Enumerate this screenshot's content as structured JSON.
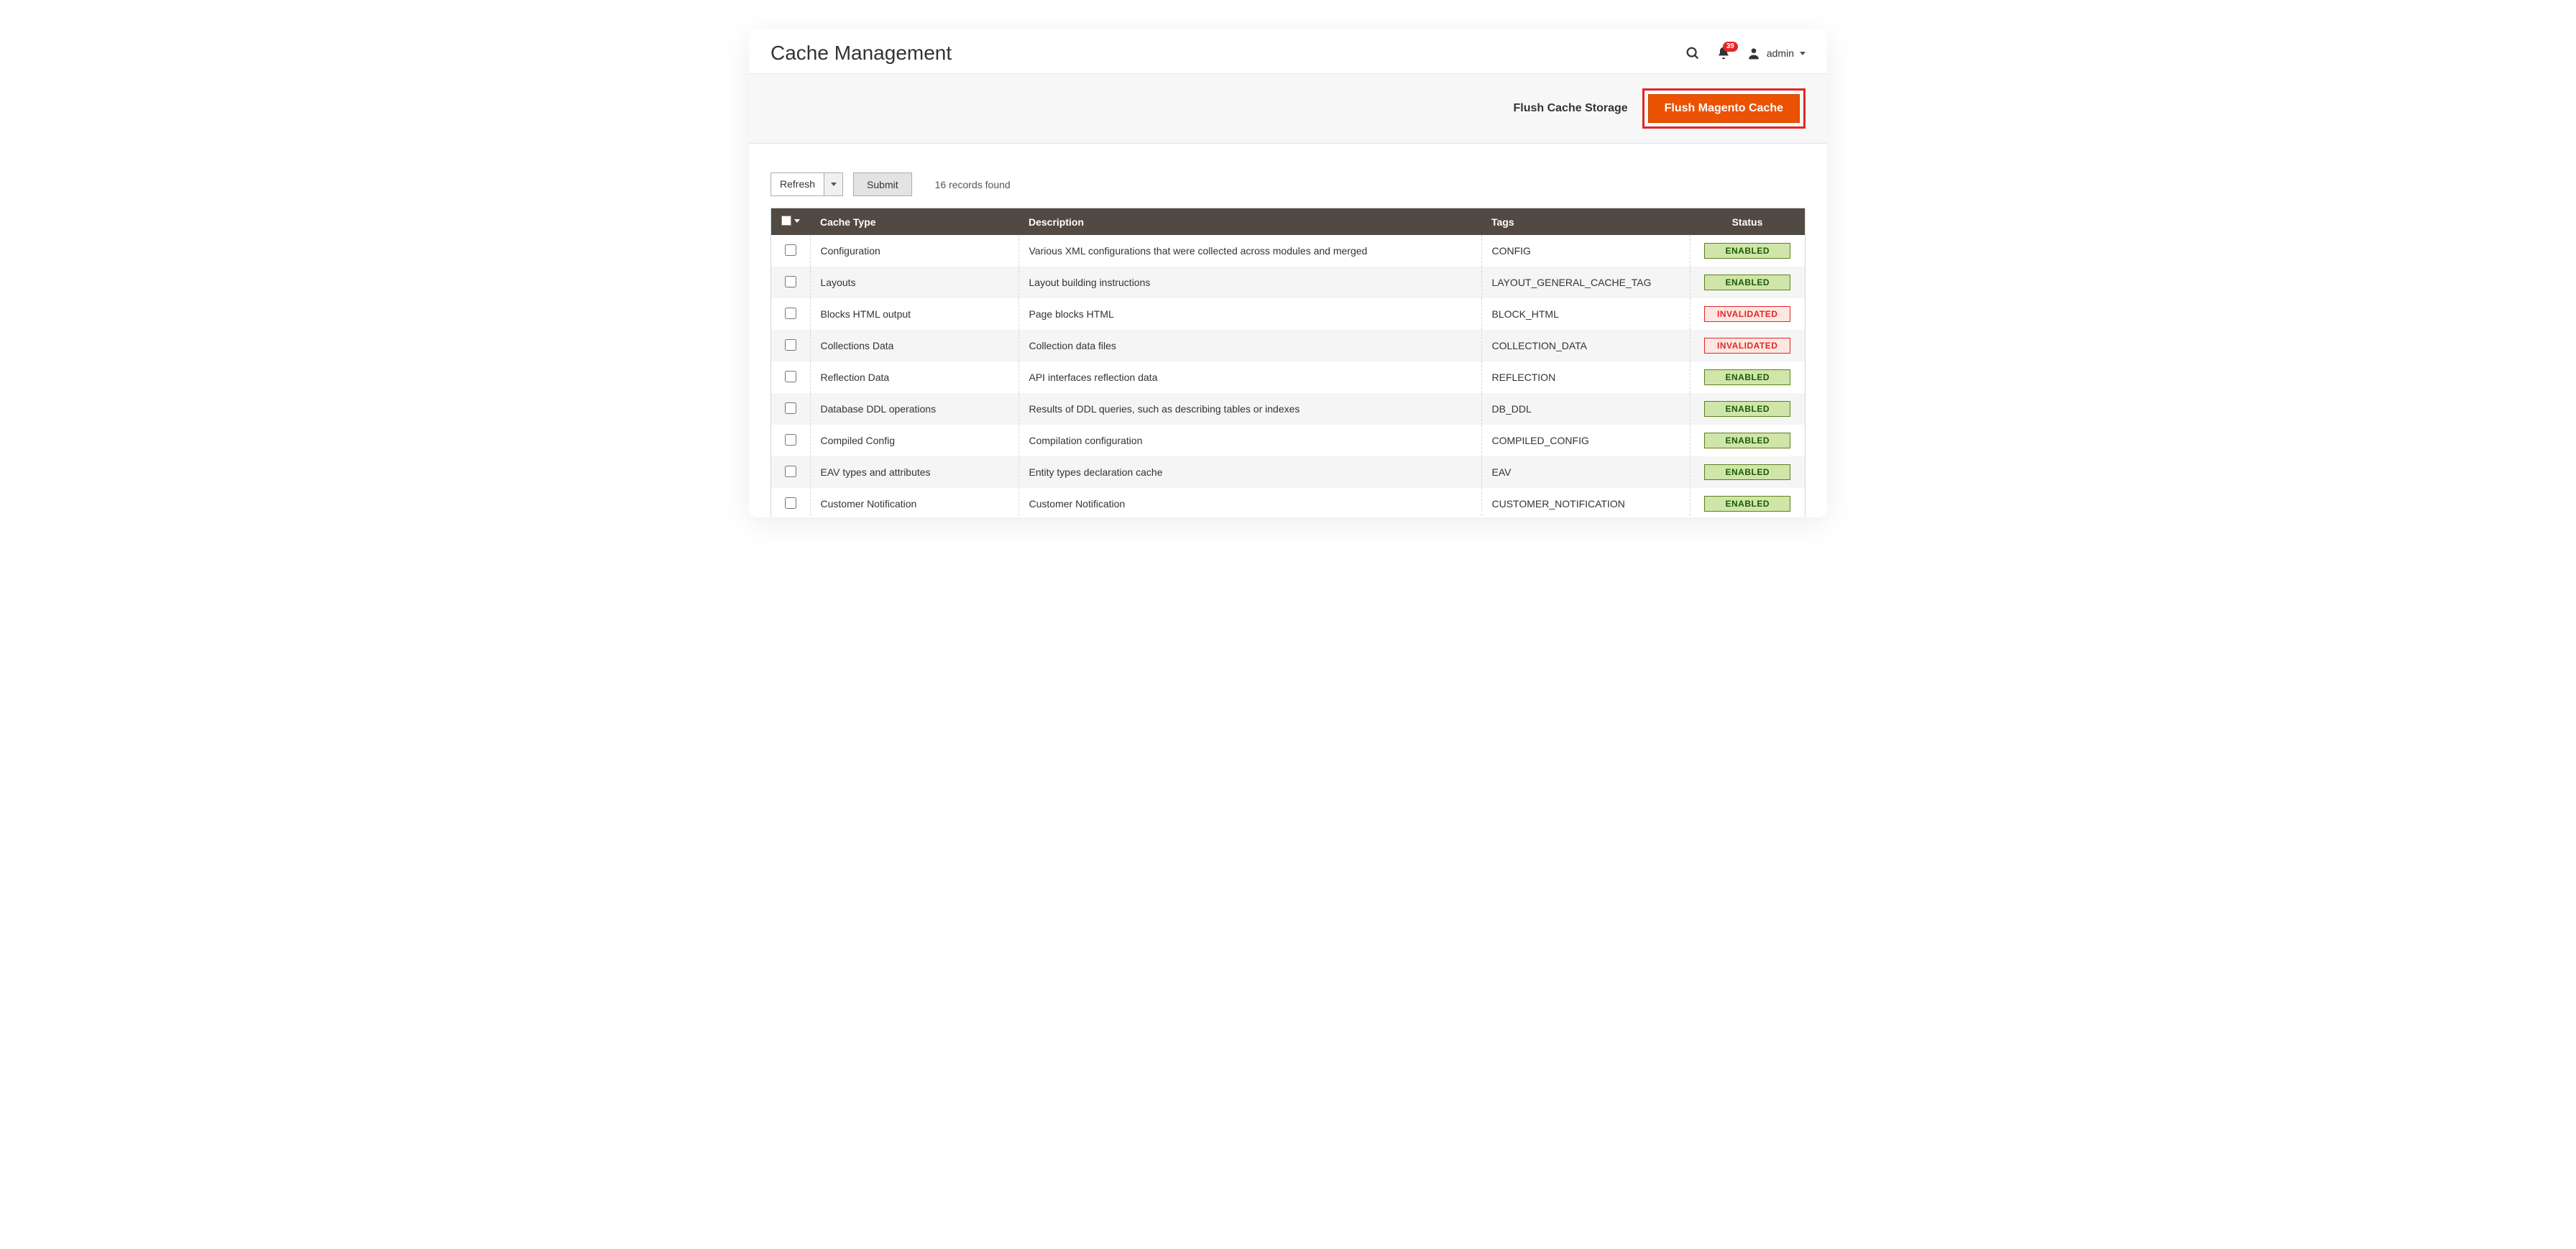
{
  "header": {
    "title": "Cache Management",
    "notif_count": "39",
    "admin_label": "admin"
  },
  "action_bar": {
    "flush_storage": "Flush Cache Storage",
    "flush_magento": "Flush Magento Cache"
  },
  "toolbar": {
    "mass_action_selected": "Refresh",
    "submit_label": "Submit",
    "records_found": "16 records found"
  },
  "table": {
    "headers": {
      "type": "Cache Type",
      "desc": "Description",
      "tags": "Tags",
      "status": "Status"
    },
    "status_labels": {
      "enabled": "ENABLED",
      "invalidated": "INVALIDATED"
    },
    "rows": [
      {
        "type": "Configuration",
        "desc": "Various XML configurations that were collected across modules and merged",
        "tags": "CONFIG",
        "status": "enabled"
      },
      {
        "type": "Layouts",
        "desc": "Layout building instructions",
        "tags": "LAYOUT_GENERAL_CACHE_TAG",
        "status": "enabled"
      },
      {
        "type": "Blocks HTML output",
        "desc": "Page blocks HTML",
        "tags": "BLOCK_HTML",
        "status": "invalidated"
      },
      {
        "type": "Collections Data",
        "desc": "Collection data files",
        "tags": "COLLECTION_DATA",
        "status": "invalidated"
      },
      {
        "type": "Reflection Data",
        "desc": "API interfaces reflection data",
        "tags": "REFLECTION",
        "status": "enabled"
      },
      {
        "type": "Database DDL operations",
        "desc": "Results of DDL queries, such as describing tables or indexes",
        "tags": "DB_DDL",
        "status": "enabled"
      },
      {
        "type": "Compiled Config",
        "desc": "Compilation configuration",
        "tags": "COMPILED_CONFIG",
        "status": "enabled"
      },
      {
        "type": "EAV types and attributes",
        "desc": "Entity types declaration cache",
        "tags": "EAV",
        "status": "enabled"
      },
      {
        "type": "Customer Notification",
        "desc": "Customer Notification",
        "tags": "CUSTOMER_NOTIFICATION",
        "status": "enabled"
      }
    ]
  }
}
